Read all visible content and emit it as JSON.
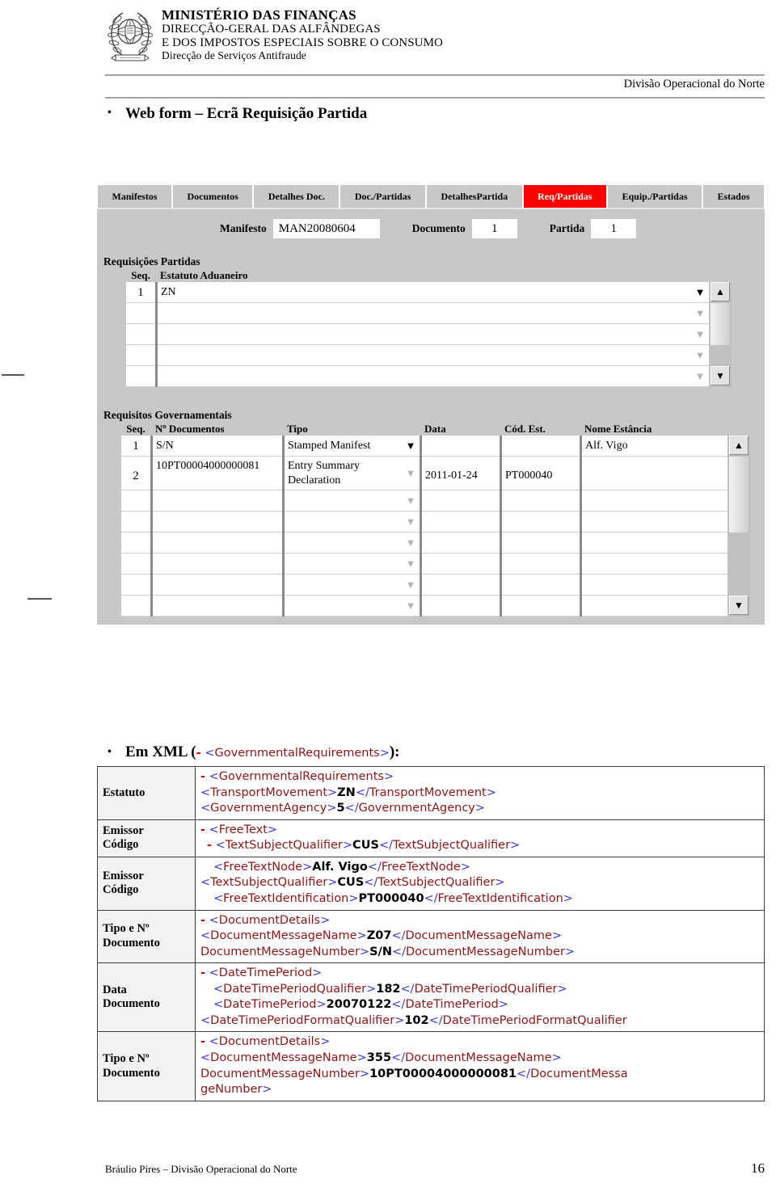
{
  "header": {
    "emblem_icon": "portugal-coat-of-arms-icon",
    "line1": "MINISTÉRIO DAS FINANÇAS",
    "line2": "DIRECÇÃO-GERAL DAS ALFÂNDEGAS",
    "line3": "E DOS IMPOSTOS ESPECIAIS SOBRE O CONSUMO",
    "line4": "Direcção de Serviços Antifraude",
    "division": "Divisão Operacional do Norte"
  },
  "slide": {
    "title": "Web form – Ecrã Requisição Partida",
    "bullet": "•"
  },
  "form": {
    "tabs": [
      {
        "label": "Manifestos",
        "active": false
      },
      {
        "label": "Documentos",
        "active": false
      },
      {
        "label": "Detalhes Doc.",
        "active": false
      },
      {
        "label": "Doc./Partidas",
        "active": false
      },
      {
        "label": "DetalhesPartida",
        "active": false
      },
      {
        "label": "Req/Partidas",
        "active": true
      },
      {
        "label": "Equip./Partidas",
        "active": false
      },
      {
        "label": "Estados",
        "active": false
      }
    ],
    "top_fields": [
      {
        "label": "Manifesto",
        "value": "MAN20080604"
      },
      {
        "label": "Documento",
        "value": "1"
      },
      {
        "label": "Partida",
        "value": "1"
      }
    ],
    "requisicoes": {
      "caption": "Requisições Partidas",
      "columns": [
        "Seq.",
        "Estatuto Aduaneiro"
      ],
      "rows": [
        {
          "seq": "1",
          "estatuto": "ZN"
        },
        {
          "seq": "",
          "estatuto": ""
        },
        {
          "seq": "",
          "estatuto": ""
        },
        {
          "seq": "",
          "estatuto": ""
        },
        {
          "seq": "",
          "estatuto": ""
        }
      ],
      "scroll_up": "▲",
      "scroll_down": "▼",
      "dropdown_glyph": "▼"
    },
    "requisitos": {
      "caption": "Requisitos Governamentais",
      "columns": [
        "Seq.",
        "Nº Documentos",
        "Tipo",
        "Data",
        "Cód. Est.",
        "Nome Estância"
      ],
      "rows": [
        {
          "seq": "1",
          "num_doc": "S/N",
          "tipo": "Stamped Manifest",
          "data": "",
          "cod_est": "",
          "nome_estancia": "Alf.  Vigo"
        },
        {
          "seq": "2",
          "num_doc": "10PT00004000000081",
          "tipo": "Entry Summary Declaration",
          "data": "2011-01-24",
          "cod_est": "PT000040",
          "nome_estancia": ""
        },
        {
          "seq": "",
          "num_doc": "",
          "tipo": "",
          "data": "",
          "cod_est": "",
          "nome_estancia": ""
        },
        {
          "seq": "",
          "num_doc": "",
          "tipo": "",
          "data": "",
          "cod_est": "",
          "nome_estancia": ""
        },
        {
          "seq": "",
          "num_doc": "",
          "tipo": "",
          "data": "",
          "cod_est": "",
          "nome_estancia": ""
        },
        {
          "seq": "",
          "num_doc": "",
          "tipo": "",
          "data": "",
          "cod_est": "",
          "nome_estancia": ""
        },
        {
          "seq": "",
          "num_doc": "",
          "tipo": "",
          "data": "",
          "cod_est": "",
          "nome_estancia": ""
        },
        {
          "seq": "",
          "num_doc": "",
          "tipo": "",
          "data": "",
          "cod_est": "",
          "nome_estancia": ""
        }
      ],
      "scroll_up": "▲",
      "scroll_down": "▼",
      "dropdown_glyph": "▼"
    }
  },
  "xml_section": {
    "heading_prefix": "Em XML (",
    "heading_minus": "-",
    "heading_tag": "<GovernmentalRequirements>",
    "heading_suffix": "):",
    "rows": [
      {
        "label": "Estatuto",
        "lines": [
          {
            "minus": "-",
            "text": "<GovernmentalRequirements>",
            "indent": 0
          },
          {
            "minus": "",
            "text": "<TransportMovement>ZN</TransportMovement>",
            "indent": 0
          },
          {
            "minus": "",
            "text": "<GovernmentAgency>5</GovernmentAgency>",
            "indent": 0
          }
        ]
      },
      {
        "label": "Emissor Código",
        "lines": [
          {
            "minus": "-",
            "text": "<FreeText>",
            "indent": 0
          },
          {
            "minus": "-",
            "text": "<TextSubjectQualifier>CUS</TextSubjectQualifier>",
            "indent": 1
          }
        ]
      },
      {
        "label": "Emissor Código",
        "lines": [
          {
            "minus": "",
            "text": "<FreeTextNode>Alf. Vigo</FreeTextNode>",
            "indent": 1
          },
          {
            "minus": "",
            "text": "<TextSubjectQualifier>CUS</TextSubjectQualifier>",
            "indent": 0
          },
          {
            "minus": "",
            "text": "<FreeTextIdentification>PT000040</FreeTextIdentification>",
            "indent": 1
          }
        ]
      },
      {
        "label": "Tipo e Nº Documento",
        "lines": [
          {
            "minus": "-",
            "text": "<DocumentDetails>",
            "indent": 0
          },
          {
            "minus": "-",
            "text": "<DocumentMessageName>Z07</DocumentMessageName>",
            "indent": 0
          },
          {
            "minus": "",
            "text": "DocumentMessageNumber>S/N</DocumentMessageNumber>",
            "indent": 0
          }
        ]
      },
      {
        "label": "Data Documento",
        "lines": [
          {
            "minus": "-",
            "text": "<DateTimePeriod>",
            "indent": 0
          },
          {
            "minus": "-",
            "text": "<DateTimePeriodQualifier>182</DateTimePeriodQualifier>",
            "indent": 1
          },
          {
            "minus": "",
            "text": "<DateTimePeriod>20070122</DateTimePeriod>",
            "indent": 1
          },
          {
            "minus": "",
            "text": "<DateTimePeriodFormatQualifier>102</DateTimePeriodFormatQualifier",
            "indent": 0
          }
        ]
      },
      {
        "label": "Tipo e Nº Documento",
        "lines": [
          {
            "minus": "-",
            "text": "<DocumentDetails>",
            "indent": 0
          },
          {
            "minus": "-",
            "text": "<DocumentMessageName>355</DocumentMessageName>",
            "indent": 0
          },
          {
            "minus": "",
            "text": "DocumentMessageNumber>10PT00004000000081</DocumentMessa",
            "indent": 0
          },
          {
            "minus": "",
            "text": "geNumber>",
            "indent": 0
          }
        ]
      }
    ],
    "colors": {
      "angle_bracket": "#3a3ad0",
      "tag_name": "#8c1616",
      "value": "#000000",
      "minus": "#cc0000"
    }
  },
  "footer": {
    "left": "Bráulio Pires – Divisão Operacional do Norte",
    "page": "16"
  }
}
